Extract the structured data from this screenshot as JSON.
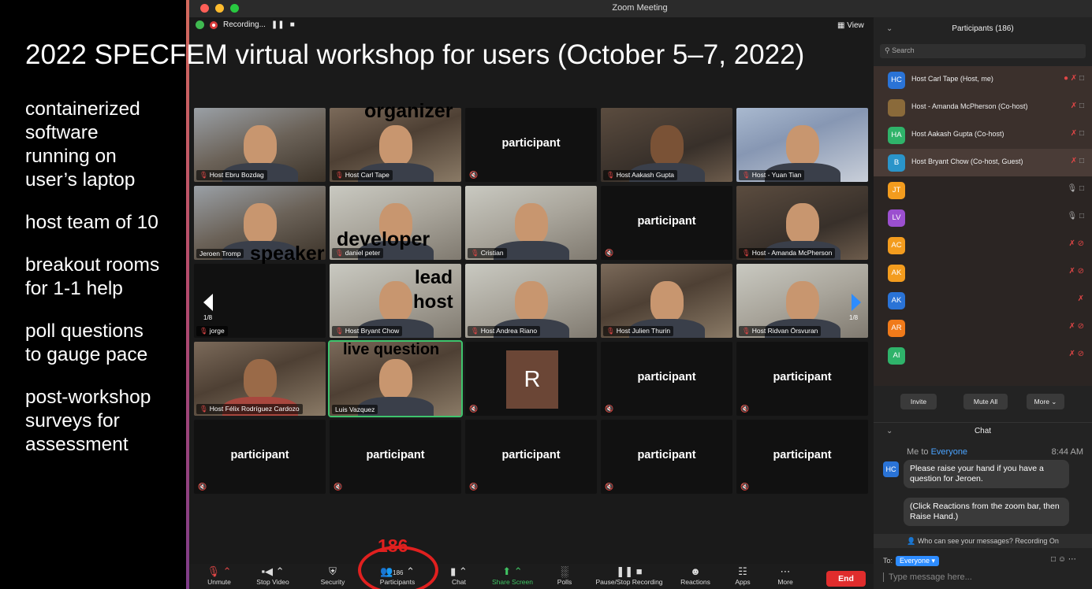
{
  "slide": {
    "title": "2022 SPECFEM virtual workshop for users (October 5–7, 2022)",
    "bullets": [
      "containerized\nsoftware\nrunning on\nuser’s laptop",
      "host team of 10",
      "breakout rooms\nfor 1-1 help",
      "poll questions\nto gauge pace",
      "post-workshop\nsurveys for\nassessment"
    ]
  },
  "window": {
    "title": "Zoom Meeting",
    "recording": "Recording...",
    "view_label": "View"
  },
  "annotations": {
    "organizer": "organizer",
    "speaker": "speaker",
    "developer": "developer",
    "lead_host_1": "lead",
    "lead_host_2": "host",
    "live_question": "live question"
  },
  "gallery": {
    "page_indicator": "1/8",
    "tiles": [
      {
        "label": "Host Ebru Bozdag"
      },
      {
        "label": "Host Carl Tape"
      },
      {
        "label": "participant"
      },
      {
        "label": "Host Aakash Gupta"
      },
      {
        "label": "Host - Yuan Tian"
      },
      {
        "label": "Jeroen Tromp"
      },
      {
        "label": "daniel peter"
      },
      {
        "label": "Cristian"
      },
      {
        "label": "participant"
      },
      {
        "label": "Host - Amanda McPherson"
      },
      {
        "label": "jorge"
      },
      {
        "label": "Host Bryant Chow"
      },
      {
        "label": "Host Andrea Riano"
      },
      {
        "label": "Host Julien Thurin"
      },
      {
        "label": "Host Ridvan Örsvuran"
      },
      {
        "label": "Host Félix Rodríguez Cardozo"
      },
      {
        "label": "Luis Vazquez"
      },
      {
        "label": "R"
      },
      {
        "label": "participant"
      },
      {
        "label": "participant"
      },
      {
        "label": "participant"
      },
      {
        "label": "participant"
      },
      {
        "label": "participant"
      },
      {
        "label": "participant"
      },
      {
        "label": "participant"
      }
    ]
  },
  "toolbar": {
    "items": [
      {
        "label": "Unmute",
        "icon": "mic-off-icon"
      },
      {
        "label": "Stop Video",
        "icon": "video-icon"
      },
      {
        "label": "Security",
        "icon": "shield-icon"
      },
      {
        "label": "Participants",
        "icon": "people-icon",
        "count": "186"
      },
      {
        "label": "Chat",
        "icon": "chat-icon"
      },
      {
        "label": "Share Screen",
        "icon": "share-icon"
      },
      {
        "label": "Polls",
        "icon": "polls-icon"
      },
      {
        "label": "Pause/Stop Recording",
        "icon": "recording-icon"
      },
      {
        "label": "Reactions",
        "icon": "reaction-icon"
      },
      {
        "label": "Apps",
        "icon": "apps-icon"
      },
      {
        "label": "More",
        "icon": "more-icon"
      }
    ],
    "end_label": "End",
    "highlight_number": "186"
  },
  "participants": {
    "title": "Participants (186)",
    "search_placeholder": "Search",
    "list": [
      {
        "initials": "HC",
        "name": "Host Carl Tape (Host, me)",
        "color": "#2a73d6"
      },
      {
        "initials": "",
        "name": "Host - Amanda McPherson (Co-host)",
        "color": "#8a6a3a"
      },
      {
        "initials": "HA",
        "name": "Host Aakash Gupta (Co-host)",
        "color": "#2fb36a"
      },
      {
        "initials": "B",
        "name": "Host Bryant Chow (Co-host, Guest)",
        "color": "#2a94c9"
      },
      {
        "initials": "JT",
        "name": "",
        "color": "#f39c1e"
      },
      {
        "initials": "LV",
        "name": "",
        "color": "#9b4fcf"
      },
      {
        "initials": "AC",
        "name": "",
        "color": "#f39c1e"
      },
      {
        "initials": "AK",
        "name": "",
        "color": "#f39c1e"
      },
      {
        "initials": "AK",
        "name": "",
        "color": "#2a73d6"
      },
      {
        "initials": "AR",
        "name": "",
        "color": "#f07a1a"
      },
      {
        "initials": "AI",
        "name": "",
        "color": "#2fb36a"
      }
    ],
    "buttons": [
      "Invite",
      "Mute All",
      "More"
    ]
  },
  "chat": {
    "title": "Chat",
    "sender": "Me to",
    "recipient": "Everyone",
    "time": "8:44 AM",
    "avatar": "HC",
    "messages": [
      "Please raise your hand if you have a question for Jeroen.",
      "(Click Reactions from the zoom bar, then Raise Hand.)"
    ],
    "who_can_see": "Who can see your messages? Recording On",
    "to_label": "To:",
    "to_value": "Everyone",
    "input_placeholder": "Type message here..."
  }
}
